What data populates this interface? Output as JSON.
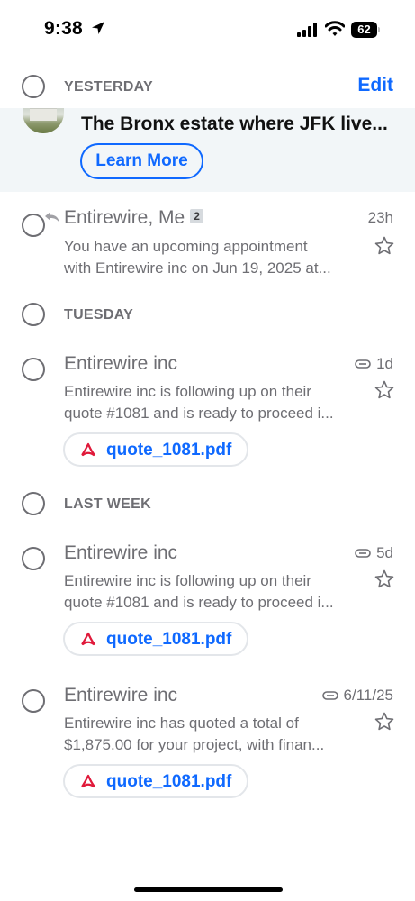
{
  "status_bar": {
    "time": "9:38",
    "battery": "62"
  },
  "header": {
    "section": "YESTERDAY",
    "edit_label": "Edit"
  },
  "promo": {
    "title": "The Bronx estate where JFK live...",
    "button": "Learn More"
  },
  "sections": {
    "tuesday": "TUESDAY",
    "last_week": "LAST WEEK"
  },
  "messages": [
    {
      "sender": "Entirewire, Me",
      "count": "2",
      "time": "23h",
      "line1": "You have an upcoming appointment",
      "line2": "with Entirewire inc on Jun 19, 2025 at..."
    },
    {
      "sender": "Entirewire inc",
      "time": "1d",
      "line1": "Entirewire inc is following up on their",
      "line2": "quote #1081 and is ready to proceed i...",
      "attachment": "quote_1081.pdf"
    },
    {
      "sender": "Entirewire inc",
      "time": "5d",
      "line1": "Entirewire inc is following up on their",
      "line2": "quote #1081 and is ready to proceed i...",
      "attachment": "quote_1081.pdf"
    },
    {
      "sender": "Entirewire inc",
      "time": "6/11/25",
      "line1": "Entirewire inc has quoted a total of",
      "line2": "$1,875.00 for your project, with finan...",
      "attachment": "quote_1081.pdf"
    }
  ],
  "icons": [
    "location-arrow-icon",
    "signal-icon",
    "wifi-icon",
    "battery-icon",
    "reply-icon",
    "attachment-icon",
    "star-icon",
    "pdf-icon"
  ],
  "colors": {
    "accent": "#0f69ff",
    "muted": "#6e6e73",
    "promo_bg": "#f2f6f8",
    "pdf_red": "#e0193a"
  }
}
